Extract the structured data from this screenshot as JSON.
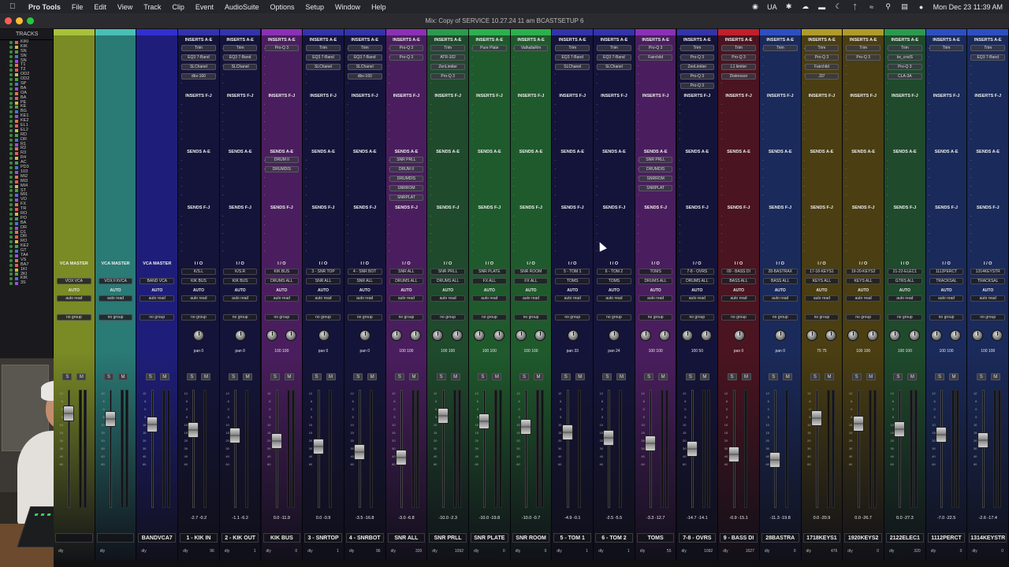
{
  "menubar": {
    "items": [
      "Pro Tools",
      "File",
      "Edit",
      "View",
      "Track",
      "Clip",
      "Event",
      "AudioSuite",
      "Options",
      "Setup",
      "Window",
      "Help"
    ],
    "status": {
      "lang": "UA",
      "datetime": "Mon Dec 23  11:39 AM"
    }
  },
  "window": {
    "title": "Mix: Copy of SERVICE 10.27.24 11 am BCASTSETUP 6"
  },
  "tracklist": {
    "header": "TRACKS",
    "rows": [
      "KIKI",
      "KIK",
      "SN",
      "SN",
      "SN",
      "T1",
      "T2",
      "OD2",
      "OD2",
      "SP",
      "BA",
      "OA",
      "BA",
      "PE",
      "KE",
      "BG",
      "KE1",
      "KE2",
      "EL1",
      "EL2",
      "RD",
      "DR",
      "R1",
      "R2",
      "R3",
      "R4",
      "AC",
      "PD3",
      "103",
      "MI2",
      "MI3",
      "MI4",
      "ST",
      "MI1",
      "VO",
      "FX",
      "TR",
      "RO",
      "PO",
      "BA",
      "DR",
      "D1",
      "DR",
      "RO",
      "KE2",
      "GT",
      "TA4",
      "VS",
      "BA7",
      "1KI",
      "2KI",
      "KIK",
      "3S"
    ]
  },
  "sections": {
    "inserts_ae": "INSERTS A-E",
    "inserts_fj": "INSERTS F-J",
    "sends_ae": "SENDS A-E",
    "sends_fj": "SENDS F-J",
    "io": "I / O",
    "auto": "AUTO",
    "auto_read": "auto read",
    "no_group": "no group",
    "pan": "pan",
    "s": "S",
    "m": "M",
    "dly": "dly"
  },
  "strips": [
    {
      "color": "#7a8a25",
      "bar": "#a7c23a",
      "name": "",
      "io_label": "VCA MASTER",
      "in": "",
      "out": "VOX VCA",
      "inserts": [],
      "sends": [],
      "vca": true,
      "vol": "",
      "pan_l": "",
      "pan_r": "",
      "dly": ""
    },
    {
      "color": "#2a7a76",
      "bar": "#48c0b6",
      "name": "",
      "io_label": "VCA MASTER",
      "in": "",
      "out": "VOX FXVCA",
      "inserts": [],
      "sends": [],
      "vca": true,
      "vol": "",
      "pan_l": "",
      "pan_r": "",
      "dly": ""
    },
    {
      "color": "#1e1e7a",
      "bar": "#3030d0",
      "name": "BANDVCA7",
      "io_label": "VCA MASTER",
      "in": "",
      "out": "BAND VCA",
      "inserts": [],
      "sends": [],
      "vca": true,
      "vol": "",
      "pan_l": "",
      "pan_r": "",
      "dly": ""
    },
    {
      "color": "#14143a",
      "bar": "#3333aa",
      "name": "1 - KIK IN",
      "io_label": "I / O",
      "in": "K/S.L",
      "out": "KIK BUS",
      "inserts": [
        "Trim",
        "EQ3 7-Band",
        "SLChanel",
        "dbx-160"
      ],
      "sends": [],
      "vol": "-2.7  -0.2",
      "pan_l": "pan",
      "pan_r": "0",
      "dly": "96",
      "mono": true
    },
    {
      "color": "#14143a",
      "bar": "#3333aa",
      "name": "2 - KIK OUT",
      "io_label": "I / O",
      "in": "K/S.R",
      "out": "KIK BUS",
      "inserts": [
        "Trim",
        "EQ3 7-Band",
        "SLChanel"
      ],
      "sends": [],
      "vol": "-1.1  -6.2",
      "pan_l": "pan",
      "pan_r": "0",
      "dly": "1",
      "mono": true
    },
    {
      "color": "#4a1e5e",
      "bar": "#8b30b5",
      "name": "KIK BUS",
      "io_label": "I / O",
      "in": "KIK BUS",
      "out": "DRUMS ALL",
      "inserts": [
        "Pro-Q 3"
      ],
      "sends": [
        "DRUM II",
        "DRUMDIS"
      ],
      "vol": "0.0  -11.9",
      "pan_l": "100",
      "pan_r": "100",
      "dly": "0"
    },
    {
      "color": "#14143a",
      "bar": "#3333aa",
      "name": "3 - SNRTOP",
      "io_label": "I / O",
      "in": "3 - SNR TOP",
      "out": "SNR ALL",
      "inserts": [
        "Trim",
        "EQ3 7-Band",
        "SLChanel"
      ],
      "sends": [],
      "vol": "0.0  -0.9",
      "pan_l": "pan",
      "pan_r": "0",
      "dly": "1",
      "mono": true
    },
    {
      "color": "#14143a",
      "bar": "#3333aa",
      "name": "4 - SNRBOT",
      "io_label": "I / O",
      "in": "4 - SNR BOT",
      "out": "SNR ALL",
      "inserts": [
        "Trim",
        "EQ3 7-Band",
        "SLChanel",
        "dbx-160"
      ],
      "sends": [],
      "vol": "-3.5  -16.8",
      "pan_l": "pan",
      "pan_r": "0",
      "dly": "96",
      "mono": true
    },
    {
      "color": "#4a1e5e",
      "bar": "#8b30b5",
      "name": "SNR ALL",
      "io_label": "I / O",
      "in": "SNR ALL",
      "out": "DRUMS ALL",
      "inserts": [
        "Pro-Q 3",
        "Pro-Q 3"
      ],
      "sends": [
        "SNR PRLL",
        "DRUM II",
        "DRUMDIS",
        "SNRROM",
        "SNRPLAT"
      ],
      "vol": "-3.0  -6.8",
      "pan_l": "100",
      "pan_r": "100",
      "dly": "320"
    },
    {
      "color": "#1f4a2c",
      "bar": "#2c9a4e",
      "name": "SNR PRLL",
      "io_label": "I / O",
      "in": "SNR PRLL",
      "out": "DRUMS ALL",
      "inserts": [
        "Trim",
        "ATR-102",
        "ZenLimiter",
        "Pro-Q 3"
      ],
      "sends": [],
      "vol": "-10.0  -2.3",
      "pan_l": "100",
      "pan_r": "100",
      "dly": "1092"
    },
    {
      "color": "#1f5a2c",
      "bar": "#2cb04e",
      "name": "SNR PLATE",
      "io_label": "I / O",
      "in": "SNR PLATE",
      "out": "FX ALL",
      "inserts": [
        "Pure Plate"
      ],
      "sends": [],
      "vol": "-10.0  -19.8",
      "pan_l": "100",
      "pan_r": "100",
      "dly": "0"
    },
    {
      "color": "#1f5a2c",
      "bar": "#2cb04e",
      "name": "SNR ROOM",
      "io_label": "I / O",
      "in": "SNR ROOM",
      "out": "FX ALL",
      "inserts": [
        "ValhallaRm"
      ],
      "sends": [],
      "vol": "-10.0  -0.7",
      "pan_l": "100",
      "pan_r": "100",
      "dly": "0"
    },
    {
      "color": "#14143a",
      "bar": "#3333aa",
      "name": "5 - TOM 1",
      "io_label": "I / O",
      "in": "5 - TOM 1",
      "out": "TOMS",
      "inserts": [
        "Trim",
        "EQ3 7-Band",
        "SLChanel"
      ],
      "sends": [],
      "vol": "-4.9  -0.1",
      "pan_l": "pan",
      "pan_r": "33",
      "dly": "1",
      "mono": true
    },
    {
      "color": "#14143a",
      "bar": "#3333aa",
      "name": "6 - TOM 2",
      "io_label": "I / O",
      "in": "6 - TOM 2",
      "out": "TOMS",
      "inserts": [
        "Trim",
        "EQ3 7-Band",
        "SLChanel"
      ],
      "sends": [],
      "vol": "-2.5  -5.5",
      "pan_l": "pan",
      "pan_r": "24",
      "dly": "1",
      "mono": true
    },
    {
      "color": "#4a1e5e",
      "bar": "#8b30b5",
      "name": "TOMS",
      "io_label": "I / O",
      "in": "TOMS",
      "out": "DRUMS ALL",
      "inserts": [
        "Pro-Q 3",
        "Fairchild"
      ],
      "sends": [
        "SNR PRLL",
        "DRUMDIS",
        "SNRROM",
        "SNRPLAT"
      ],
      "vol": "-3.3  -12.7",
      "pan_l": "100",
      "pan_r": "100",
      "dly": "55"
    },
    {
      "color": "#14143a",
      "bar": "#3333aa",
      "name": "7-8 - OVRS",
      "io_label": "I / O",
      "in": "7-8 - OVRS",
      "out": "DRUMS ALL",
      "inserts": [
        "Trim",
        "Pro-Q 3",
        "ZenLimiter",
        "Pro-Q 3",
        "Pro-Q 3"
      ],
      "sends": [],
      "vol": "-14.7  -14.1",
      "pan_l": "100",
      "pan_r": "50",
      "dly": "1092"
    },
    {
      "color": "#4a1420",
      "bar": "#c0202c",
      "name": "9 - BASS DI",
      "io_label": "I / O",
      "in": "09 - BASS DI",
      "out": "BASS ALL",
      "inserts": [
        "Trim",
        "Pro-Q 3",
        "L1 limiter",
        "Distressor"
      ],
      "sends": [],
      "vol": "-0.9  -15.1",
      "pan_l": "pan",
      "pan_r": "0",
      "dly": "1527",
      "mono": true
    },
    {
      "color": "#1a2a5a",
      "bar": "#2e4ec0",
      "name": "28BASTRA",
      "io_label": "I / O",
      "in": "28-BASTRAX",
      "out": "BASS ALL",
      "inserts": [
        "Trim"
      ],
      "sends": [],
      "vol": "-11.3  -19.8",
      "pan_l": "pan",
      "pan_r": "0",
      "dly": "0",
      "mono": true
    },
    {
      "color": "#4a3e12",
      "bar": "#b09a2a",
      "name": "1718KEYS1",
      "io_label": "I / O",
      "in": "17-18-KEYS1",
      "out": "KEYS ALL",
      "inserts": [
        "Trim",
        "Pro-Q 3",
        "Fairchild",
        "J37"
      ],
      "sends": [],
      "vol": "0.0  -20.9",
      "pan_l": "75",
      "pan_r": "75",
      "dly": "476"
    },
    {
      "color": "#4a3e12",
      "bar": "#b09a2a",
      "name": "1920KEYS2",
      "io_label": "I / O",
      "in": "19-20-KEYS2",
      "out": "KEYS ALL",
      "inserts": [
        "Trim",
        "Pro-Q 3"
      ],
      "sends": [],
      "vol": "0.0  -26.7",
      "pan_l": "100",
      "pan_r": "100",
      "dly": "0"
    },
    {
      "color": "#1f4a2c",
      "bar": "#2c9a4e",
      "name": "2122ELEC1",
      "io_label": "I / O",
      "in": "21-22-ELEC1",
      "out": "GTRS ALL",
      "inserts": [
        "Trim",
        "bx_cnslS",
        "Pro-Q 3",
        "CLA-3A"
      ],
      "sends": [],
      "vol": "0.0  -27.3",
      "pan_l": "100",
      "pan_r": "100",
      "dly": "320"
    },
    {
      "color": "#1a2a5a",
      "bar": "#2e4ec0",
      "name": "1112PERCT",
      "io_label": "I / O",
      "in": "1112PERCT",
      "out": "TRACKSAL",
      "inserts": [
        "Trim"
      ],
      "sends": [],
      "vol": "-7.0  -22.5",
      "pan_l": "100",
      "pan_r": "100",
      "dly": "0"
    },
    {
      "color": "#1a2a5a",
      "bar": "#2e4ec0",
      "name": "1314KEYSTR",
      "io_label": "I / O",
      "in": "1314KEYSTR",
      "out": "TRACKSAL",
      "inserts": [
        "Trim",
        "EQ3 7-Band"
      ],
      "sends": [],
      "vol": "-2.6  -17.4",
      "pan_l": "100",
      "pan_r": "100",
      "dly": "0"
    }
  ]
}
